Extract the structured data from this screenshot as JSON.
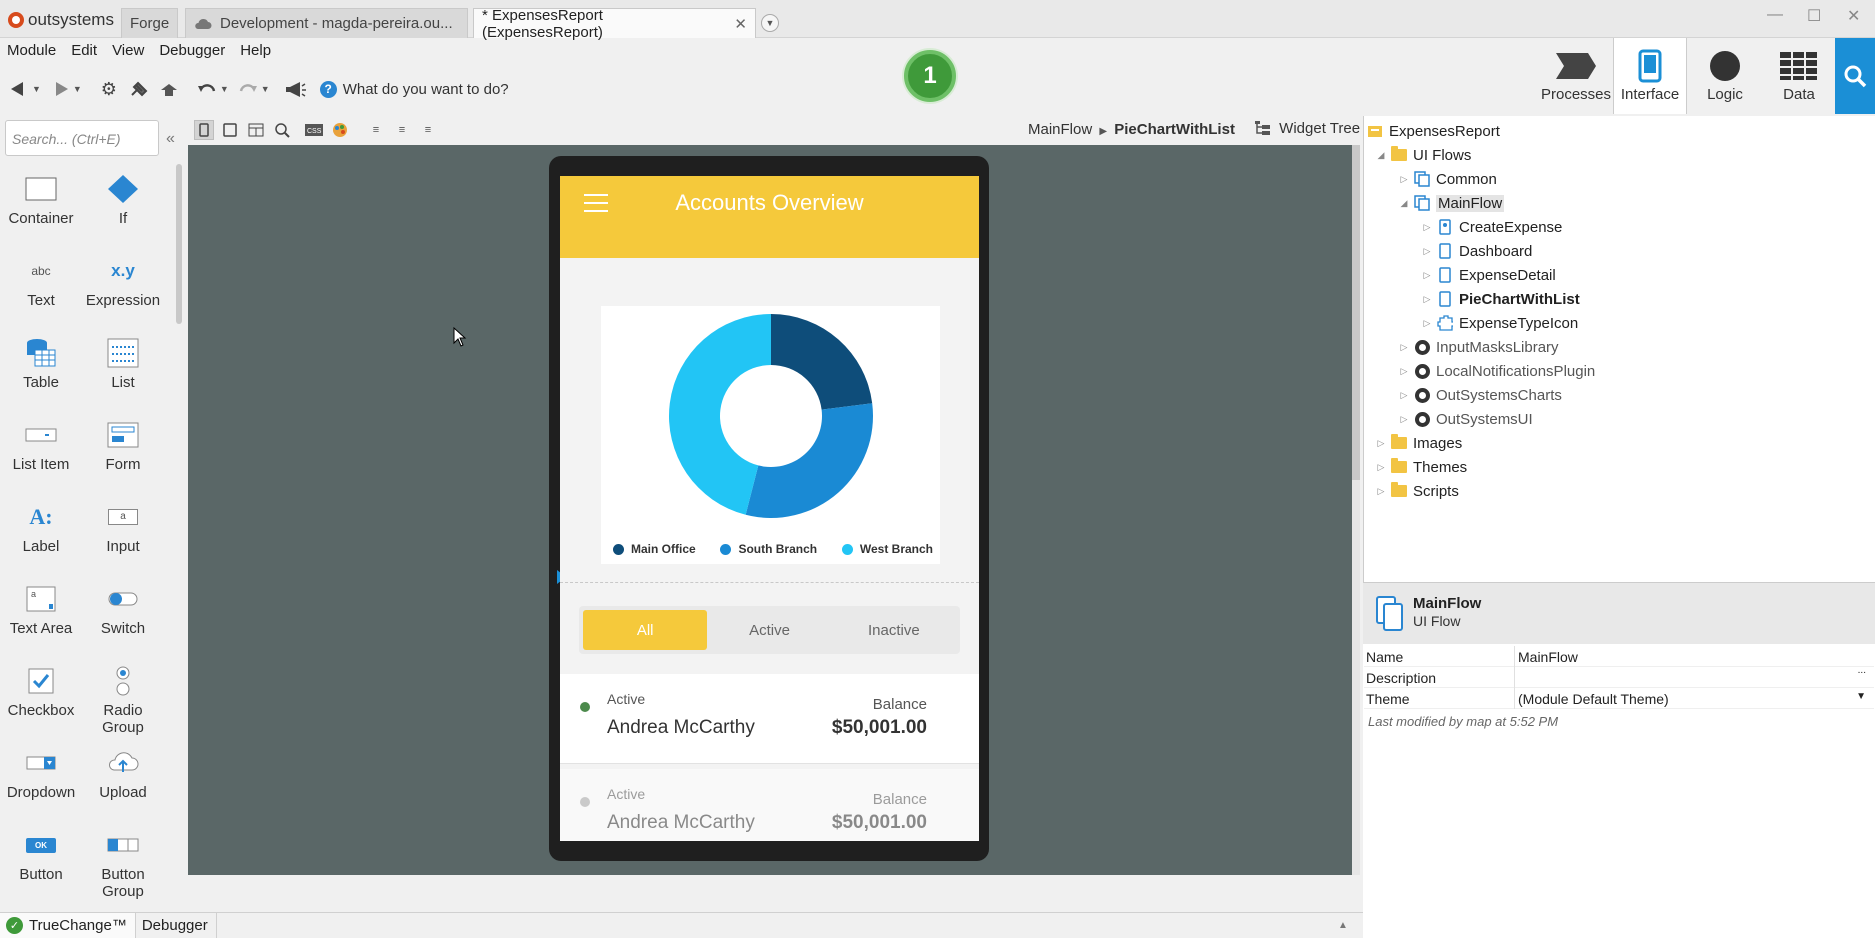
{
  "app": {
    "logo": "outsystems",
    "tabs": [
      {
        "label": "Forge"
      },
      {
        "label": "Development - magda-pereira.ou..."
      },
      {
        "label": "* ExpensesReport (ExpensesReport)"
      }
    ],
    "close_glyph": "✕"
  },
  "menu": [
    "Module",
    "Edit",
    "View",
    "Debugger",
    "Help"
  ],
  "toolbar": {
    "ask_placeholder": "What do you want to do?",
    "badge": "1"
  },
  "right_nav": [
    {
      "label": "Processes",
      "icon": "processes-icon"
    },
    {
      "label": "Interface",
      "icon": "interface-icon"
    },
    {
      "label": "Logic",
      "icon": "logic-icon"
    },
    {
      "label": "Data",
      "icon": "data-icon"
    }
  ],
  "palette": {
    "search_placeholder": "Search... (Ctrl+E)",
    "widgets": [
      {
        "label": "Container"
      },
      {
        "label": "If"
      },
      {
        "label": "Text"
      },
      {
        "label": "Expression"
      },
      {
        "label": "Table"
      },
      {
        "label": "List"
      },
      {
        "label": "List Item"
      },
      {
        "label": "Form"
      },
      {
        "label": "Label"
      },
      {
        "label": "Input"
      },
      {
        "label": "Text Area"
      },
      {
        "label": "Switch"
      },
      {
        "label": "Checkbox"
      },
      {
        "label": "Radio Group"
      },
      {
        "label": "Dropdown"
      },
      {
        "label": "Upload"
      },
      {
        "label": "Button"
      },
      {
        "label": "Button Group"
      }
    ],
    "icon_texts": {
      "text": "abc",
      "expression": "x.y",
      "label": "A:",
      "ok": "OK",
      "input": "a"
    }
  },
  "editor": {
    "breadcrumb_parent": "MainFlow",
    "breadcrumb_current": "PieChartWithList",
    "widget_tree": "Widget Tree"
  },
  "preview": {
    "title": "Accounts Overview",
    "chart": {
      "legend": [
        {
          "name": "Main Office",
          "color": "#0e4d7a"
        },
        {
          "name": "South Branch",
          "color": "#1a8ad4"
        },
        {
          "name": "West Branch",
          "color": "#22c5f5"
        }
      ]
    },
    "filters": [
      {
        "label": "All",
        "active": true
      },
      {
        "label": "Active",
        "active": false
      },
      {
        "label": "Inactive",
        "active": false
      }
    ],
    "accounts": [
      {
        "status": "Active",
        "name": "Andrea McCarthy",
        "balance_label": "Balance",
        "amount": "$50,001.00"
      },
      {
        "status": "Active",
        "name": "Andrea McCarthy",
        "balance_label": "Balance",
        "amount": "$50,001.00"
      }
    ],
    "colors": {
      "accent": "#f5c93b",
      "status_green": "#4c8a4c",
      "status_gray": "#aaaaaa"
    }
  },
  "chart_data": {
    "type": "pie",
    "categories": [
      "Main Office",
      "South Branch",
      "West Branch"
    ],
    "values": [
      23,
      31,
      46
    ],
    "colors": [
      "#0e4d7a",
      "#1a8ad4",
      "#22c5f5"
    ],
    "title": "",
    "legend": "bottom",
    "donut": true
  },
  "explorer": {
    "items": [
      {
        "label": "ExpensesReport"
      },
      {
        "label": "UI Flows"
      },
      {
        "label": "Common"
      },
      {
        "label": "MainFlow"
      },
      {
        "label": "CreateExpense"
      },
      {
        "label": "Dashboard"
      },
      {
        "label": "ExpenseDetail"
      },
      {
        "label": "PieChartWithList"
      },
      {
        "label": "ExpenseTypeIcon"
      },
      {
        "label": "InputMasksLibrary"
      },
      {
        "label": "LocalNotificationsPlugin"
      },
      {
        "label": "OutSystemsCharts"
      },
      {
        "label": "OutSystemsUI"
      },
      {
        "label": "Images"
      },
      {
        "label": "Themes"
      },
      {
        "label": "Scripts"
      }
    ]
  },
  "properties": {
    "title": "MainFlow",
    "subtitle": "UI Flow",
    "rows": [
      {
        "key": "Name",
        "value": "MainFlow"
      },
      {
        "key": "Description",
        "value": "..."
      },
      {
        "key": "Theme",
        "value": "(Module Default Theme)"
      }
    ],
    "modified": "Last modified by map at 5:52 PM"
  },
  "statusbar": {
    "truechange": "TrueChange™",
    "debugger": "Debugger"
  }
}
